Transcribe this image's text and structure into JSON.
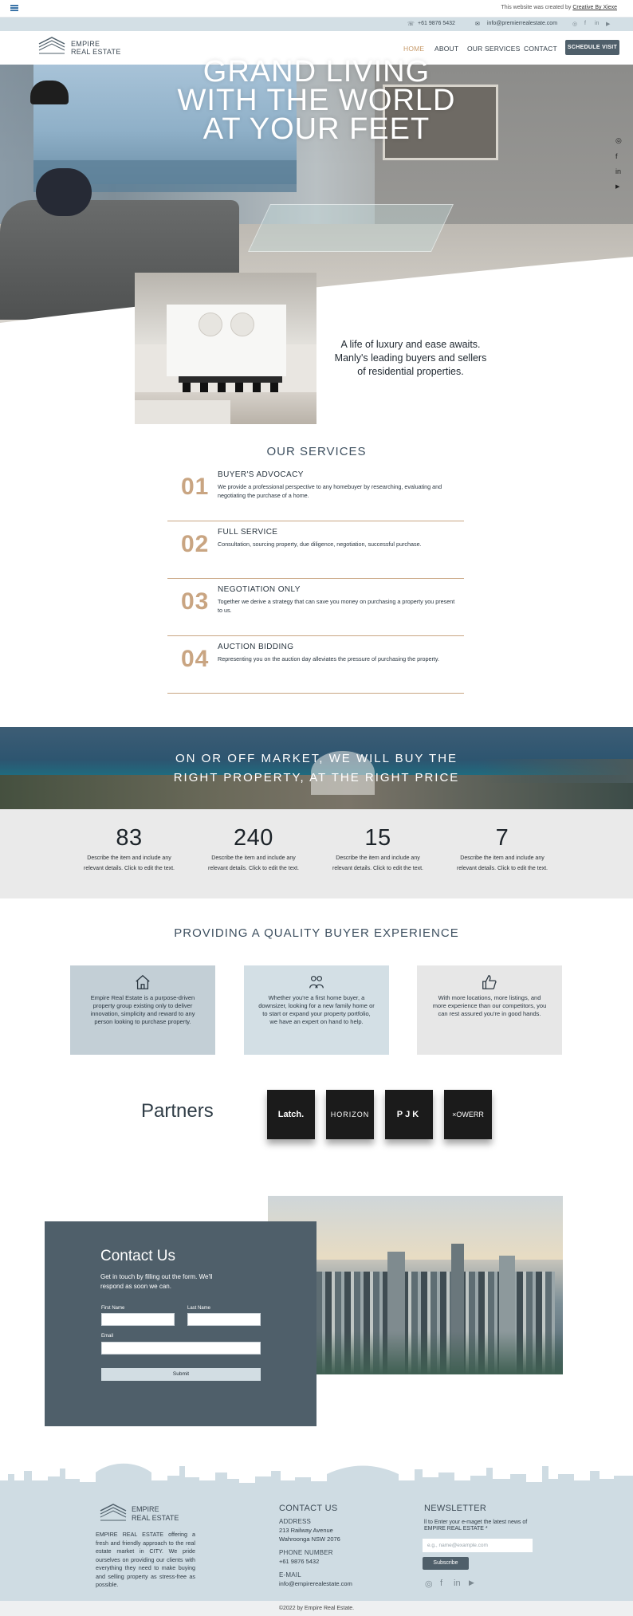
{
  "creator_bar": {
    "text": "This website was created by ",
    "link": "Creative By Xiexe"
  },
  "contact_strip": {
    "phone": "+61 9876 5432",
    "email": "info@premierrealestate.com"
  },
  "brand": {
    "line1": "EMPIRE",
    "line2": "REAL ESTATE"
  },
  "nav": {
    "items": [
      "HOME",
      "ABOUT",
      "OUR SERVICES",
      "CONTACT"
    ],
    "cta": "SCHEDULE VISIT"
  },
  "hero": {
    "line1": "GRAND LIVING",
    "line2": "WITH THE WORLD",
    "line3": "AT YOUR FEET"
  },
  "intro": {
    "text": "A life of luxury and ease awaits. Manly's leading buyers and sellers of residential properties."
  },
  "services": {
    "title": "OUR SERVICES",
    "items": [
      {
        "num": "01",
        "title": "BUYER'S ADVOCACY",
        "desc": "We provide a professional perspective to any homebuyer by researching, evaluating and negotiating the purchase of a home."
      },
      {
        "num": "02",
        "title": "FULL SERVICE",
        "desc": "Consultation, sourcing property, due diligence, negotiation, successful purchase."
      },
      {
        "num": "03",
        "title": "NEGOTIATION ONLY",
        "desc": "Together we derive a strategy that can save you money on purchasing a property you present to us."
      },
      {
        "num": "04",
        "title": "AUCTION BIDDING",
        "desc": "Representing you on the auction day alleviates the pressure of purchasing the property."
      }
    ]
  },
  "market": {
    "line1": "ON OR OFF MARKET, WE WILL BUY THE",
    "line2": "RIGHT PROPERTY, AT THE RIGHT PRICE"
  },
  "stats": [
    {
      "num": "83",
      "desc": "Describe the item and include any relevant details. Click to edit the text."
    },
    {
      "num": "240",
      "desc": "Describe the item and include any relevant details. Click to edit the text."
    },
    {
      "num": "15",
      "desc": "Describe the item and include any relevant details. Click to edit the text."
    },
    {
      "num": "7",
      "desc": "Describe the item and include any relevant details. Click to edit the text."
    }
  ],
  "quality": {
    "title": "PROVIDING A QUALITY BUYER EXPERIENCE",
    "cards": [
      {
        "icon": "house-icon",
        "color": "#c3cfd6",
        "text": "Empire Real Estate is a purpose-driven property group existing only to deliver innovation, simplicity and reward to any person looking to purchase property."
      },
      {
        "icon": "people-icon",
        "color": "#d3dfe5",
        "text": "Whether you're a first home buyer, a downsizer, looking for a new family home or to start or expand your property portfolio, we have an expert on hand to help."
      },
      {
        "icon": "thumbs-up-icon",
        "color": "#e7e7e7",
        "text": "With more locations, more listings, and more experience than our competitors, you can rest assured you're in good hands."
      }
    ]
  },
  "partners": {
    "title": "Partners",
    "logos": [
      "Latch.",
      "HORIZON",
      "PJK",
      "×OWERR"
    ]
  },
  "contact": {
    "title": "Contact Us",
    "subtitle": "Get in touch by filling out the form. We'll respond as soon we can.",
    "first_name": "First Name",
    "last_name": "Last Name",
    "email": "Email",
    "submit": "Submit"
  },
  "footer": {
    "about": "EMPIRE REAL ESTATE offering a fresh and friendly approach to the real estate market in CITY. We pride ourselves on providing our clients with everything they need to make buying and selling property as stress-free as possible.",
    "contact_title": "CONTACT US",
    "address_label": "ADDRESS",
    "address_1": "213 Railway Avenue",
    "address_2": "Wahroonga NSW 2076",
    "phone_label": "PHONE NUMBER",
    "phone": "+61 9876 5432",
    "email_label": "E-MAIL",
    "email": "info@empirerealestate.com",
    "newsletter_title": "NEWSLETTER",
    "newsletter_text": "ll to Enter your e-maget the latest news of EMPIRE REAL ESTATE *",
    "newsletter_placeholder": "e.g., name@example.com",
    "subscribe": "Subscribe",
    "copyright": "©2022 by Empire Real Estate."
  },
  "colors": {
    "accent": "#c9a582",
    "dark": "#4f5f6a",
    "light_blue": "#d3dfe5"
  }
}
